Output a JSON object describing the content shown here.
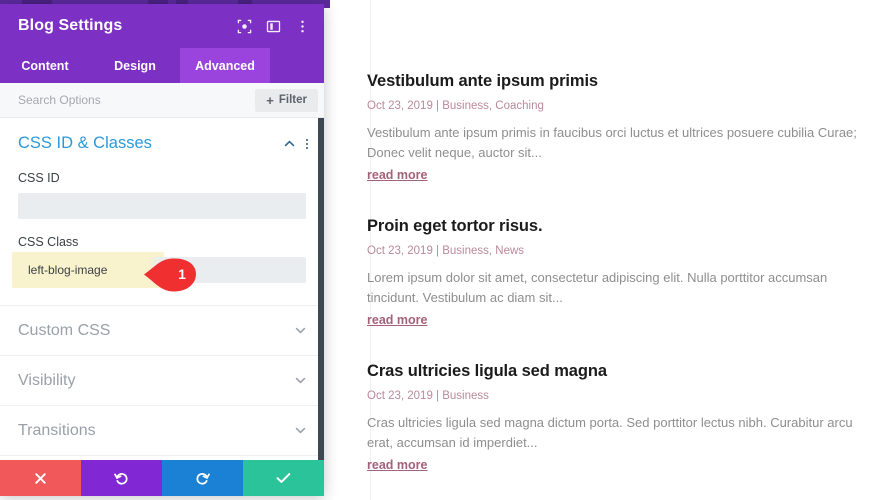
{
  "panel": {
    "title": "Blog Settings",
    "header_icons": [
      {
        "name": "focus-icon",
        "label": "focus"
      },
      {
        "name": "layout-icon",
        "label": "layout"
      },
      {
        "name": "more-options-icon",
        "label": "more"
      }
    ],
    "tabs": [
      {
        "label": "Content",
        "active": false
      },
      {
        "label": "Design",
        "active": false
      },
      {
        "label": "Advanced",
        "active": true
      }
    ],
    "search": {
      "placeholder": "Search Options",
      "value": ""
    },
    "filter_button": {
      "plus": "+",
      "label": "Filter"
    },
    "open_section": {
      "title": "CSS ID & Classes",
      "fields": [
        {
          "label": "CSS ID",
          "value": "",
          "placeholder": "",
          "highlighted": false
        },
        {
          "label": "CSS Class",
          "value": "left-blog-image",
          "placeholder": "",
          "highlighted": true
        }
      ]
    },
    "callout": {
      "number": "1",
      "color": "#f03030"
    },
    "collapsed_sections": [
      {
        "title": "Custom CSS"
      },
      {
        "title": "Visibility"
      },
      {
        "title": "Transitions"
      }
    ],
    "footer_buttons": [
      {
        "name": "cancel-button",
        "icon": "close-icon",
        "color": "#f0585a"
      },
      {
        "name": "undo-button",
        "icon": "undo-icon",
        "color": "#8128d4"
      },
      {
        "name": "redo-button",
        "icon": "redo-icon",
        "color": "#1a81d4"
      },
      {
        "name": "save-button",
        "icon": "check-icon",
        "color": "#2bc49a"
      }
    ],
    "colors": {
      "header": "#7d30c4",
      "tab_active": "#9a44dd",
      "section_title": "#2b99d9",
      "highlight": "#f7f1c4"
    }
  },
  "blog": {
    "posts": [
      {
        "title": "Vestibulum ante ipsum primis",
        "meta": "Oct 23, 2019 | Business, Coaching",
        "excerpt": "Vestibulum ante ipsum primis in faucibus orci luctus et ultrices posuere cubilia Curae; Donec velit neque, auctor sit...",
        "read_more": "read more"
      },
      {
        "title": "Proin eget tortor risus.",
        "meta": "Oct 23, 2019 | Business, News",
        "excerpt": "Lorem ipsum dolor sit amet, consectetur adipiscing elit. Nulla porttitor accumsan tincidunt. Vestibulum ac diam sit...",
        "read_more": "read more"
      },
      {
        "title": "Cras ultricies ligula sed magna",
        "meta": "Oct 23, 2019 | Business",
        "excerpt": "Cras ultricies ligula sed magna dictum porta. Sed porttitor lectus nibh. Curabitur arcu erat, accumsan id imperdiet...",
        "read_more": "read more"
      }
    ]
  }
}
